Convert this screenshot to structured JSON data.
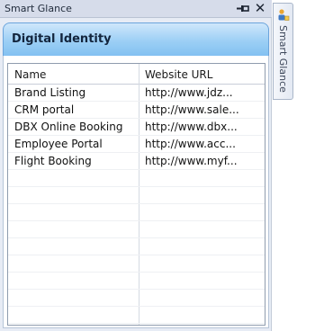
{
  "window": {
    "title": "Smart Glance",
    "pin_icon": "pin-icon",
    "close_glyph": "✕"
  },
  "panel": {
    "title": "Digital Identity"
  },
  "grid": {
    "columns": [
      "Name",
      "Website URL"
    ],
    "rows": [
      {
        "name": "Brand Listing",
        "url": "http://www.jdz..."
      },
      {
        "name": "CRM portal",
        "url": "http://www.sale..."
      },
      {
        "name": "DBX Online Booking",
        "url": "http://www.dbx..."
      },
      {
        "name": "Employee Portal",
        "url": "http://www.acc..."
      },
      {
        "name": "Flight Booking",
        "url": "http://www.myf..."
      }
    ]
  },
  "side_tab": {
    "label": "Smart Glance",
    "icon": "smart-glance-icon"
  },
  "colors": {
    "header_gradient_top": "#cfe7fb",
    "header_gradient_bottom": "#83c1f1",
    "panel_background": "#e7ecf5"
  }
}
